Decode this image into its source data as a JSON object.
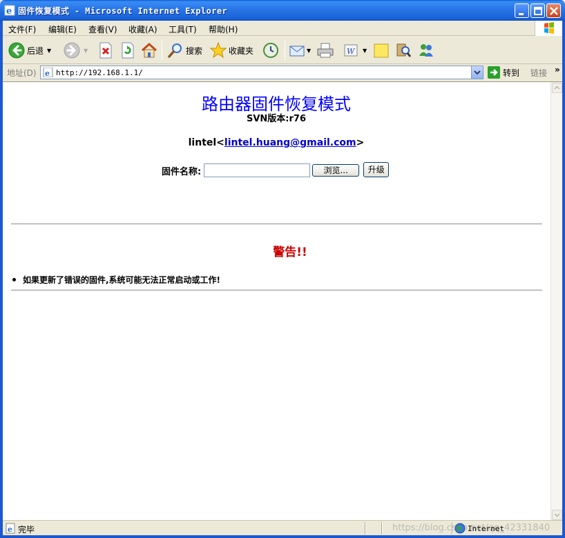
{
  "window": {
    "title": "固件恢复模式 - Microsoft Internet Explorer"
  },
  "menu": {
    "items": [
      "文件(F)",
      "编辑(E)",
      "查看(V)",
      "收藏(A)",
      "工具(T)",
      "帮助(H)"
    ]
  },
  "toolbar": {
    "back_label": "后退",
    "search_label": "搜索",
    "favorites_label": "收藏夹"
  },
  "address": {
    "label": "地址(D)",
    "url": "http://192.168.1.1/",
    "go_label": "转到",
    "links_label": "链接"
  },
  "page": {
    "title": "路由器固件恢复模式",
    "svn": "SVN版本:r76",
    "author_name": "lintel<",
    "author_email": "lintel.huang@gmail.com",
    "author_close": ">",
    "firmware_label": "固件名称:",
    "file_value": "",
    "browse_label": "浏览...",
    "upgrade_label": "升级",
    "warning_title": "警告!!",
    "warning_items": [
      "如果更新了错误的固件,系统可能无法正常启动或工作!"
    ]
  },
  "status": {
    "text": "完毕",
    "zone": "Internet",
    "watermark": "https://blog.csdn.net/qq_42331840"
  },
  "colors": {
    "title_link": "#0000ff",
    "warning": "#cc0000",
    "titlebar": "#2a78ea"
  },
  "icons": {
    "back": "back-arrow-icon",
    "forward": "forward-arrow-icon",
    "stop": "stop-icon",
    "refresh": "refresh-icon",
    "home": "home-icon",
    "search": "search-icon",
    "favorites": "star-icon",
    "history": "history-icon",
    "mail": "mail-icon",
    "print": "print-icon",
    "edit": "word-icon",
    "notes": "note-icon",
    "research": "research-icon",
    "messenger": "messenger-icon"
  }
}
